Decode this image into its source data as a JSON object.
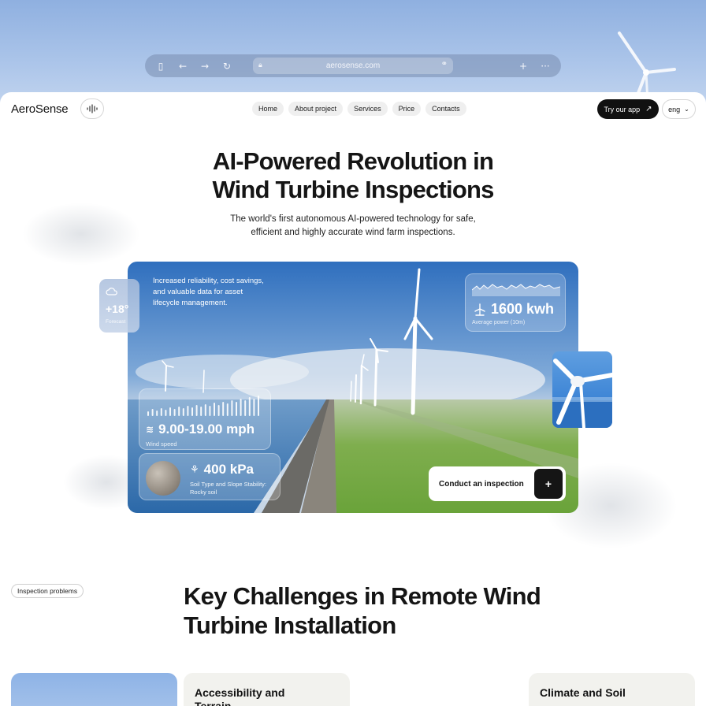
{
  "browser": {
    "url": "aerosense.com"
  },
  "header": {
    "logo": "AeroSense",
    "nav": [
      "Home",
      "About project",
      "Services",
      "Price",
      "Contacts"
    ],
    "cta_label": "Try our app",
    "language": "eng"
  },
  "hero": {
    "title_line1": "AI-Powered Revolution in",
    "title_line2": "Wind Turbine Inspections",
    "subtitle_line1": "The world's first autonomous AI-powered technology for safe,",
    "subtitle_line2": "efficient and highly accurate wind farm inspections.",
    "copy_line1": "Increased reliability, cost savings,",
    "copy_line2": "and valuable data for asset",
    "copy_line3": "lifecycle management.",
    "weather": {
      "temp": "+18°",
      "label": "Forecast"
    },
    "power": {
      "value": "1600 kwh",
      "label": "Average power (10m)"
    },
    "wind": {
      "value": "9.00-19.00 mph",
      "label": "Wind speed"
    },
    "soil": {
      "value": "400 kPa",
      "label_line1": "Soil Type and Slope Stability:",
      "label_line2": "Rocky soil"
    },
    "inspection_label": "Conduct an inspection",
    "inspection_button": "+"
  },
  "section": {
    "chip": "Inspection problems",
    "title_line1": "Key Challenges in Remote Wind",
    "title_line2": "Turbine Installation",
    "cards": [
      {
        "title_line1": "Accessibility and",
        "title_line2": "Terrain"
      },
      {
        "title_line1": "Climate and Soil",
        "title_line2": ""
      }
    ]
  },
  "colors": {
    "accent_dark": "#111111",
    "sky": "#a9c3e6",
    "card_bg": "#f2f2ee"
  }
}
